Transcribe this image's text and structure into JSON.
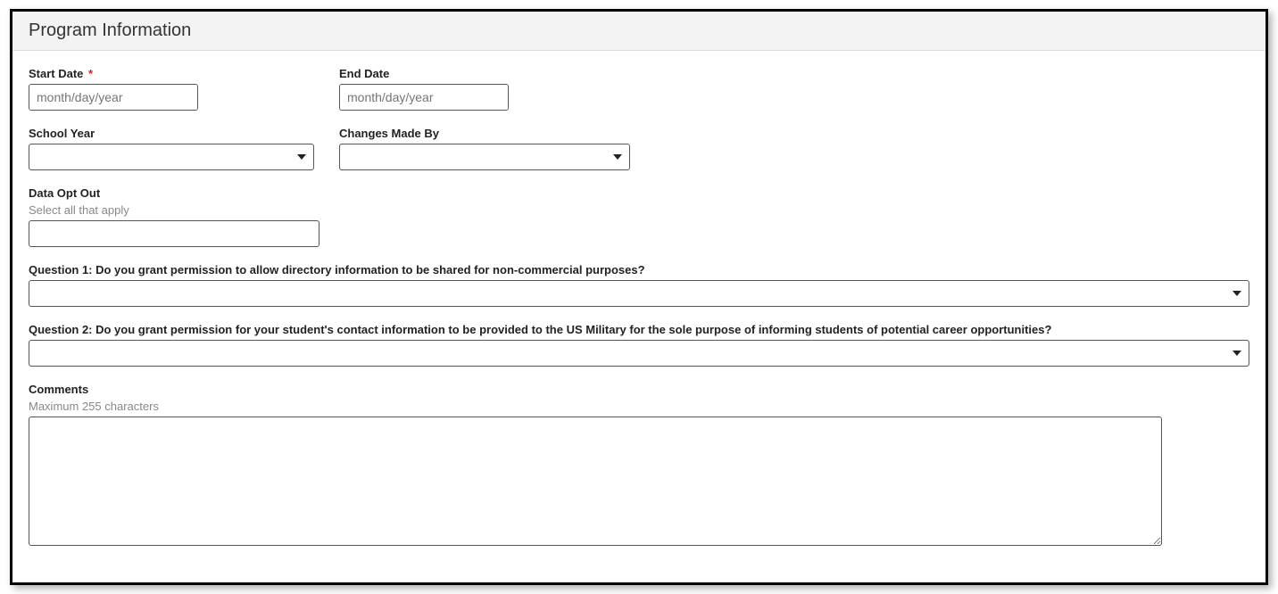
{
  "header": {
    "title": "Program Information"
  },
  "fields": {
    "startDate": {
      "label": "Start Date",
      "required": "*",
      "placeholder": "month/day/year"
    },
    "endDate": {
      "label": "End Date",
      "placeholder": "month/day/year"
    },
    "schoolYear": {
      "label": "School Year"
    },
    "changesMadeBy": {
      "label": "Changes Made By"
    },
    "dataOptOut": {
      "label": "Data Opt Out",
      "helper": "Select all that apply"
    },
    "q1": {
      "label": "Question 1: Do you grant permission to allow directory information to be shared for non-commercial purposes?"
    },
    "q2": {
      "label": "Question 2: Do you grant permission for your student's contact information to be provided to the US Military for the sole purpose of informing students of potential career opportunities?"
    },
    "comments": {
      "label": "Comments",
      "helper": "Maximum 255 characters"
    }
  }
}
